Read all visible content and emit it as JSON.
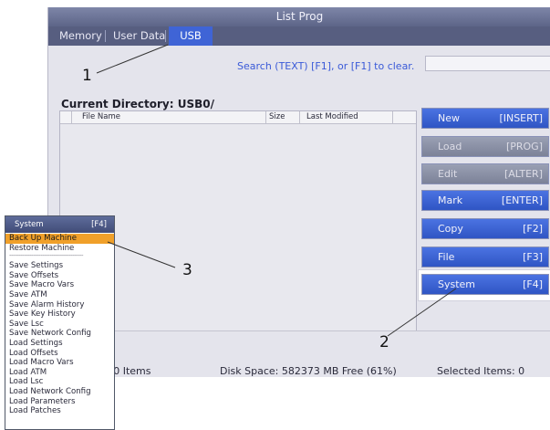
{
  "window": {
    "title": "List Prog"
  },
  "tabs": [
    {
      "label": "Memory"
    },
    {
      "label": "User Data"
    },
    {
      "label": "USB",
      "active": true
    }
  ],
  "search": {
    "hint": "Search (TEXT) [F1], or [F1] to clear.",
    "value": ""
  },
  "current_directory": "Current Directory: USB0/",
  "file_table": {
    "columns": [
      "File Name",
      "Size",
      "Last Modified"
    ],
    "rows": []
  },
  "side_buttons": [
    {
      "label": "New",
      "key": "[INSERT]",
      "enabled": true
    },
    {
      "label": "Load",
      "key": "[PROG]",
      "enabled": false
    },
    {
      "label": "Edit",
      "key": "[ALTER]",
      "enabled": false
    },
    {
      "label": "Mark",
      "key": "[ENTER]",
      "enabled": true
    },
    {
      "label": "Copy",
      "key": "[F2]",
      "enabled": true
    },
    {
      "label": "File",
      "key": "[F3]",
      "enabled": true
    },
    {
      "label": "System",
      "key": "[F4]",
      "enabled": true
    }
  ],
  "status": {
    "items": ": 0 Items",
    "disk_space": "Disk Space: 582373 MB Free (61%)",
    "selected": "Selected Items: 0"
  },
  "system_menu": {
    "title": "System",
    "key": "[F4]",
    "items": [
      "Back Up Machine",
      "Restore Machine",
      "----------------------------------------",
      "Save Settings",
      "Save Offsets",
      "Save Macro Vars",
      "Save ATM",
      "Save Alarm History",
      "Save Key History",
      "Save Lsc",
      "Save Network Config",
      "Load Settings",
      "Load Offsets",
      "Load Macro Vars",
      "Load ATM",
      "Load Lsc",
      "Load Network Config",
      "Load Parameters",
      "Load Patches"
    ],
    "selected_index": 0
  },
  "callouts": [
    "1",
    "2",
    "3"
  ],
  "colors": {
    "accent": "#3f64d6",
    "highlight": "#f0a02a",
    "titlebar": "#6e7698"
  }
}
